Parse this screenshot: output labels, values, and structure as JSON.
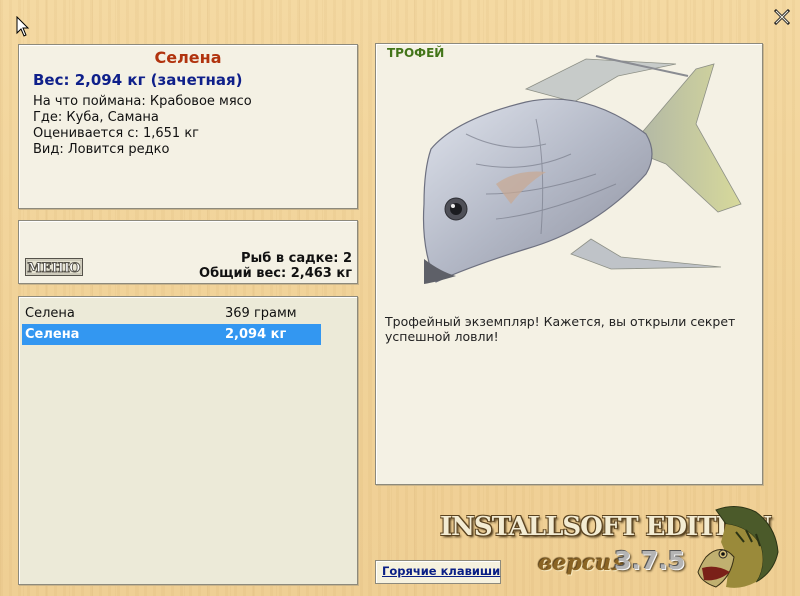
{
  "fish": {
    "name": "Селена",
    "weight_line": "Вес: 2,094 кг (зачетная)",
    "bait": "На что поймана: Крабовое мясо",
    "location": "Где: Куба, Самана",
    "valued_from": "Оценивается с: 1,651 кг",
    "rarity": "Вид: Ловится редко"
  },
  "cage": {
    "menu_label": "МЕНЮ",
    "count_text": "Рыб в садке: 2",
    "total_text": "Общий вес: 2,463 кг"
  },
  "catch_list": [
    {
      "name": "Селена",
      "weight": "369 грамм",
      "selected": false
    },
    {
      "name": "Селена",
      "weight": "2,094 кг",
      "selected": true
    }
  ],
  "trophy": {
    "label": "ТРОФЕЙ",
    "message": "Трофейный экземпляр! Кажется, вы открыли секрет успешной ловли!"
  },
  "branding": {
    "title": "INSTALLSOFT EDITION",
    "version_label": "версия",
    "version_number": "3.7.5"
  },
  "buttons": {
    "hotkeys": "Горячие клавиши"
  },
  "icons": {
    "close": "close-icon",
    "cursor": "mouse-cursor-icon",
    "fish_image": "moonfish-image",
    "logo": "pike-fish-logo"
  },
  "colors": {
    "selection": "#3397f1",
    "title": "#b1330e",
    "weight": "#0f208a",
    "trophy_label": "#437519"
  }
}
